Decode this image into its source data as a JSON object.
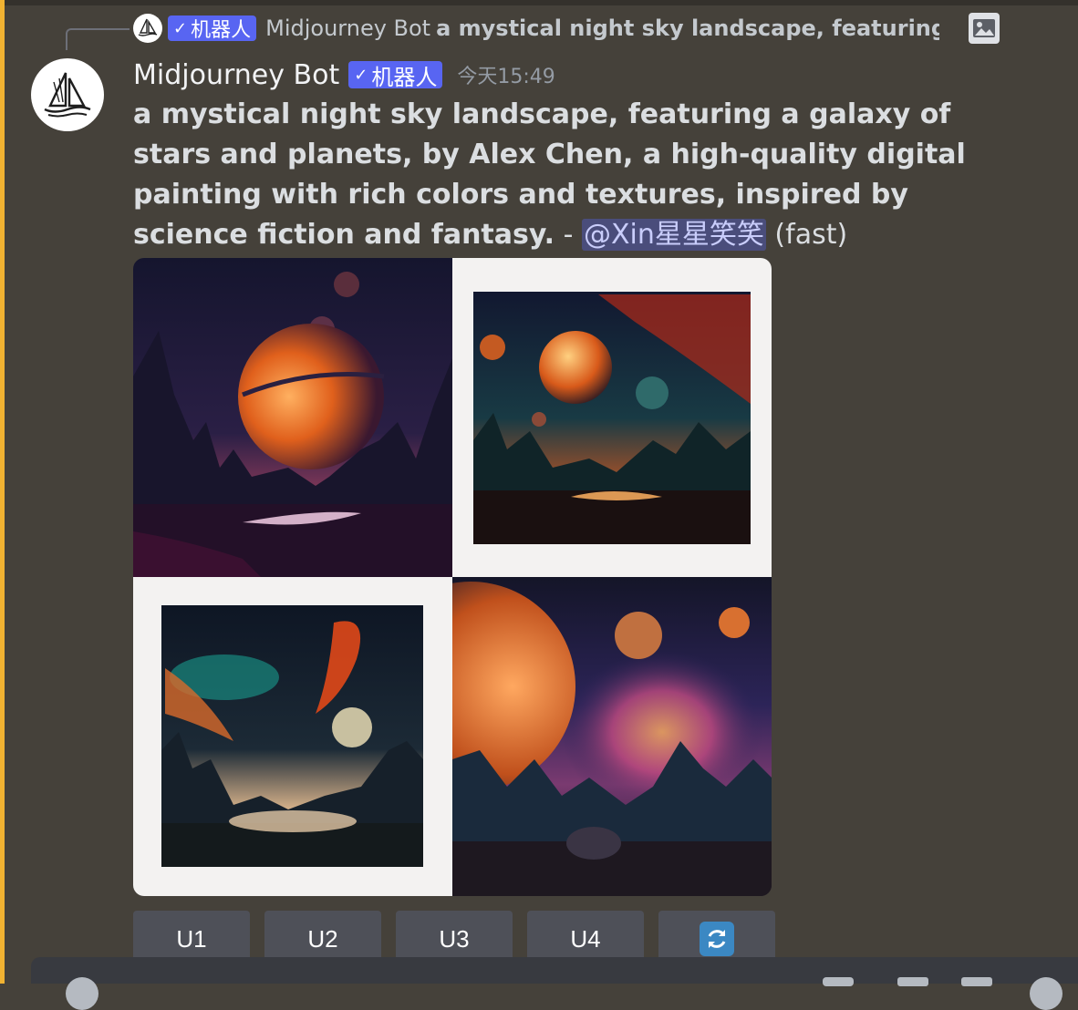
{
  "reply": {
    "author": "Midjourney Bot",
    "badge": "机器人",
    "snippet": "a mystical night sky landscape, featuring a ga"
  },
  "message": {
    "author": "Midjourney Bot",
    "badge": "机器人",
    "timestamp": "今天15:49",
    "prompt": "a mystical night sky landscape, featuring a galaxy of stars and planets, by Alex Chen, a high-quality digital painting with rich colors and textures, inspired by science fiction and fantasy.",
    "dash": " - ",
    "mention": "@Xin星星笑笑",
    "mode": " (fast)"
  },
  "buttons": [
    {
      "label": "U1"
    },
    {
      "label": "U2"
    },
    {
      "label": "U3"
    },
    {
      "label": "U4"
    },
    {
      "label": "",
      "icon": "reroll-icon"
    }
  ],
  "colors": {
    "background": "#45413a",
    "bot_badge": "#5865f2",
    "mention_bg": "#4a4d7b",
    "mention_bar": "#f0b232",
    "button_bg": "#4e5058"
  }
}
